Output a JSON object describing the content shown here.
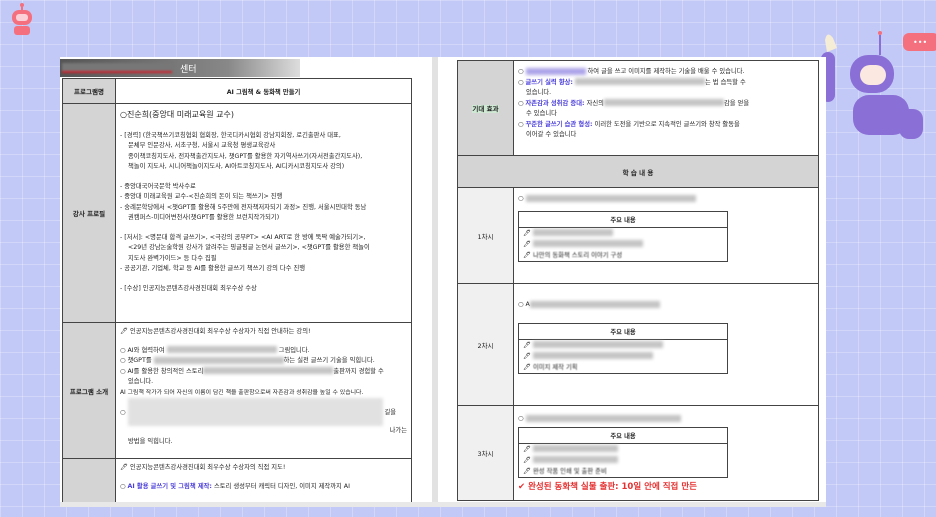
{
  "left_page": {
    "banner": "센터",
    "program_name_label": "프로그램명",
    "program_name": "AI 그림책 & 동화책 만들기",
    "instructor_label": "강사 프로필",
    "instructor_name": "○진순희(중앙대 미래교육원 교수)",
    "career": [
      "- [경력] (한국책쓰기코칭협회 협회장, 한국디카시협회 강남지회장, 로긴출판사 대표,",
      "문체부 인문강사, 서초구청, 서울시 교육청 평생교육강사",
      "종이책코칭지도사, 전자책출간지도사, 챗GPT를 활용한 자기역사쓰기(자서전출간지도사),",
      "책놀이 지도사, 시니어책놀이지도사, AI아트코칭지도사, AI디카시코칭지도사 강의)"
    ],
    "education": [
      "- 중앙대국어국문학 박사수료",
      "- 중앙대 미래교육원 교수-<진순희의 돈이 되는 책쓰기> 진행",
      "- 숭례문학당에서 <챗GPT를 활용해 5주만에 전자책저자되기 과정> 진행, 서울시민대학 동남",
      "권캠퍼스-미디어변천사(챗GPT를 활용한 브런치작가되기)"
    ],
    "books": [
      "- [저서]: <명문대 합격 글쓰기>, <극강의 공부PT> <AI ART로 한 방에 뚝딱 예술가되기>,",
      "<29년 강남논술학원 강사가 알려주는 핑글핑글 논연서 글쓰기>, <챗GPT를 활용한 책놀이",
      "지도사 완벽가이드> 등 다수 집필",
      "- 공공기관, 기업체, 학교 등 AI를 활용한 글쓰기 책쓰기 강의 다수 진행"
    ],
    "award": "- [수상] 인공지능콘텐츠강사경진대회 최우수상 수상",
    "intro_label": "프로그램 소개",
    "intro_head": "인공지능콘텐츠강사경진대회 최우수상 수상자가 직접 안내하는 강의!",
    "intro_items": [
      "AI와 협력하여",
      "그림입니다.",
      "챗GPT를",
      "하는 실전 글쓰기 기술을 익힙니다.",
      "AI를 활용한 창의적인 스토리",
      "출판까지 경험할 수",
      "있습니다.",
      "AI 그림책 작가가 되어 자신의 이름이 담긴 책을 출판함으로써 자존감과 성취감을 높일 수 있습니다.",
      "길을",
      "나가는",
      "방법을 익힙니다."
    ],
    "next_head": "인공지능콘텐츠강사경진대회 최우수상 수상자의 직접 지도!",
    "next_item_blue": "AI 활용 글쓰기 및 그림책 제작:",
    "next_item_text": "스토리 생성부터 캐릭터 디자인, 이미지 제작까지 AI"
  },
  "right_page": {
    "effects_label": "기대 효과",
    "effects": [
      {
        "blue": "",
        "text": "하여 글을 쓰고 이미지를 제작하는 기술을 배울 수 있습니다."
      },
      {
        "blue": "글쓰기 실력 향상:",
        "text": "는 법 습득할 수",
        "cont": "있습니다."
      },
      {
        "blue": "자존감과 성취감 증대:",
        "text": "자신의",
        "tail": "감을 얻을",
        "cont": "수 있습니다"
      },
      {
        "blue": "꾸준한 글쓰기 습관 형성:",
        "text": "이러한 도전을 기반으로 지속적인 글쓰기와 창작 활동을",
        "cont": "이어갈 수 있습니다"
      }
    ],
    "content_header": "학 습 내 용",
    "sessions": [
      {
        "label": "1차시",
        "lead": "",
        "box_title": "주요 내용",
        "last": "나만의 동화책 스토리 이야기 구성"
      },
      {
        "label": "2차시",
        "lead": "A",
        "box_title": "주요 내용",
        "last": "이미지 제작 기획"
      },
      {
        "label": "3차시",
        "lead": "",
        "box_title": "주요 내용",
        "last": "완성 작품 인쇄 및 출판 준비"
      }
    ],
    "published": "✔ 완성된 동화책 실물 출판: 10일 안에 직접 만든"
  },
  "colors": {
    "background": "#c3c9f7",
    "label_cell": "#d4d4d4",
    "accent_blue": "#4b3fd8",
    "red": "#e53030",
    "robot_purple": "#8a6fd6",
    "robot_pink": "#f4707f"
  }
}
